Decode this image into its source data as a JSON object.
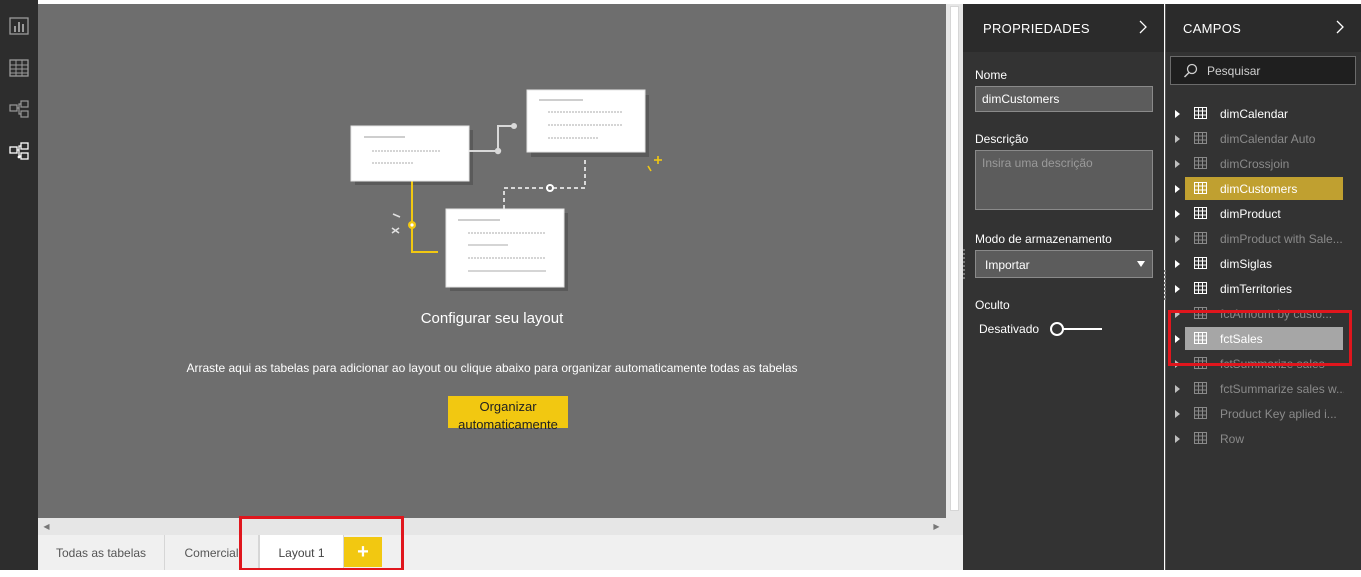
{
  "canvas": {
    "title": "Configurar seu layout",
    "instruction": "Arraste aqui as tabelas para adicionar ao layout ou clique abaixo para organizar automaticamente todas as tabelas",
    "organize_button": [
      "Organizar",
      "automaticamente"
    ]
  },
  "tabs": [
    {
      "label": "Todas as tabelas"
    },
    {
      "label": "Comercial"
    },
    {
      "label": "Layout 1",
      "active": true
    }
  ],
  "tab_add_label": "+",
  "properties": {
    "title": "PROPRIEDADES",
    "name_label": "Nome",
    "name_value": "dimCustomers",
    "description_label": "Descrição",
    "description_placeholder": "Insira uma descrição",
    "storage_label": "Modo de armazenamento",
    "storage_value": "Importar",
    "hidden_label": "Oculto",
    "hidden_state": "Desativado"
  },
  "fields": {
    "title": "CAMPOS",
    "search_placeholder": "Pesquisar",
    "items": [
      {
        "label": "dimCalendar",
        "state": "normal"
      },
      {
        "label": "dimCalendar Auto",
        "state": "dim"
      },
      {
        "label": "dimCrossjoin",
        "state": "dim"
      },
      {
        "label": "dimCustomers",
        "state": "selected"
      },
      {
        "label": "dimProduct",
        "state": "normal"
      },
      {
        "label": "dimProduct with Sale...",
        "state": "dim"
      },
      {
        "label": "dimSiglas",
        "state": "normal"
      },
      {
        "label": "dimTerritories",
        "state": "normal"
      },
      {
        "label": "fctAmount by custo...",
        "state": "dim"
      },
      {
        "label": "fctSales",
        "state": "hover"
      },
      {
        "label": "fctSummarize sales",
        "state": "dim"
      },
      {
        "label": "fctSummarize sales w...",
        "state": "dim"
      },
      {
        "label": "Product Key aplied i...",
        "state": "dim"
      },
      {
        "label": "Row",
        "state": "dim"
      }
    ]
  },
  "colors": {
    "accent": "#f2c811",
    "selected_bg": "#c0a030",
    "hover_bg": "#a6a6a6",
    "highlight_border": "#e0161d",
    "canvas_bg": "#6e6e6e",
    "panel_bg": "#333333"
  },
  "icons": [
    "report-view-icon",
    "data-view-icon",
    "model-view-icon",
    "layout-view-icon",
    "search-icon",
    "table-icon",
    "chevron-right-icon",
    "dropdown-caret-icon",
    "expand-caret-icon",
    "add-icon"
  ]
}
